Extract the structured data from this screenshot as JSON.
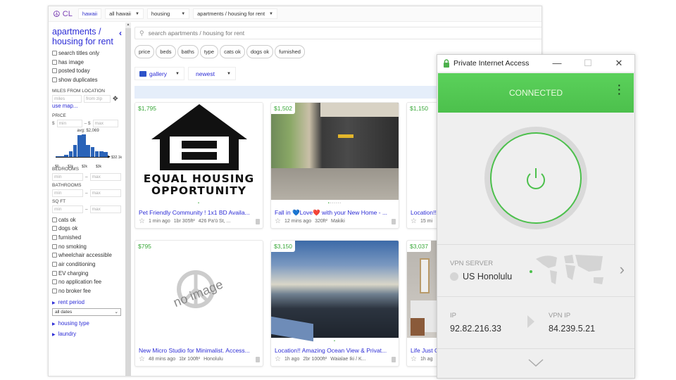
{
  "browser": {
    "site_logo": "CL",
    "breadcrumbs": [
      {
        "label": "hawaii"
      },
      {
        "label": "all hawaii"
      },
      {
        "label": "housing"
      },
      {
        "label": "apartments / housing for rent"
      }
    ]
  },
  "sidebar": {
    "title": "apartments / housing for rent",
    "collapse_icon": "chevron-left",
    "options": [
      "search titles only",
      "has image",
      "posted today",
      "show duplicates"
    ],
    "miles_label": "MILES FROM LOCATION",
    "miles_placeholder": "miles",
    "zip_placeholder": "from zip",
    "use_map": "use map...",
    "price_label": "PRICE",
    "price_min_prefix": "$",
    "price_min_placeholder": "min",
    "price_max_prefix": "– $",
    "price_max_placeholder": "max",
    "histogram": {
      "avg_label": "avg: $2,069",
      "max_label": "$32.1k",
      "ticks": [
        "$0",
        "$1k",
        "$2k",
        "$3k"
      ],
      "bars": [
        0.04,
        0.05,
        0.1,
        0.24,
        0.5,
        0.88,
        0.9,
        0.5,
        0.4,
        0.25,
        0.25,
        0.22
      ]
    },
    "bedrooms_label": "BEDROOMS",
    "bathrooms_label": "BATHROOMS",
    "sqft_label": "SQ FT",
    "min_placeholder": "min",
    "max_placeholder": "max",
    "range_sep": "–",
    "amenities": [
      "cats ok",
      "dogs ok",
      "furnished",
      "no smoking",
      "wheelchair accessible",
      "air conditioning",
      "EV charging",
      "no application fee",
      "no broker fee"
    ],
    "rent_period": "rent period",
    "date_select": "all dates",
    "housing_type": "housing type",
    "laundry": "laundry"
  },
  "main": {
    "search_placeholder": "search apartments / housing for rent",
    "chips": [
      "price",
      "beds",
      "baths",
      "type",
      "cats ok",
      "dogs ok",
      "furnished"
    ],
    "view_label": "gallery",
    "sort_label": "newest",
    "listings": [
      {
        "price": "$1,795",
        "title": "Pet Friendly Community ! 1x1 BD Availa...",
        "age": "1 min ago",
        "size": "1br 305ft²",
        "location": "426 Pa'ū St, ...",
        "image": "equal-housing",
        "image_text": [
          "EQUAL HOUSING",
          "OPPORTUNITY"
        ]
      },
      {
        "price": "$1,502",
        "title": "Fall in 💙Love❤️ with your New Home - ...",
        "age": "12 mins ago",
        "size": "320ft²",
        "location": "Makiki",
        "image": "building-photo"
      },
      {
        "price": "$1,150",
        "title": "Location!!",
        "age": "15 mi",
        "size": "",
        "location": "",
        "image": "photo"
      },
      {
        "price": "$795",
        "title": "New Micro Studio for Minimalist. Access...",
        "age": "48 mins ago",
        "size": "1br 100ft²",
        "location": "Honolulu",
        "image": "no-image",
        "image_text": [
          "no image"
        ]
      },
      {
        "price": "$3,150",
        "title": "Location!! Amazing Ocean View & Privat...",
        "age": "1h ago",
        "size": "2br 1000ft²",
        "location": "Waialae Iki / K...",
        "image": "ocean-photo"
      },
      {
        "price": "$3,037",
        "title": "Life Just C",
        "age": "1h ag",
        "size": "",
        "location": "",
        "image": "bedroom-photo"
      }
    ]
  },
  "vpn": {
    "app_title": "Private Internet Access",
    "status": "CONNECTED",
    "status_color": "#4cc04c",
    "server_label": "VPN SERVER",
    "server_value": "US Honolulu",
    "ip_label": "IP",
    "ip_value": "92.82.216.33",
    "vpn_ip_label": "VPN IP",
    "vpn_ip_value": "84.239.5.21"
  }
}
